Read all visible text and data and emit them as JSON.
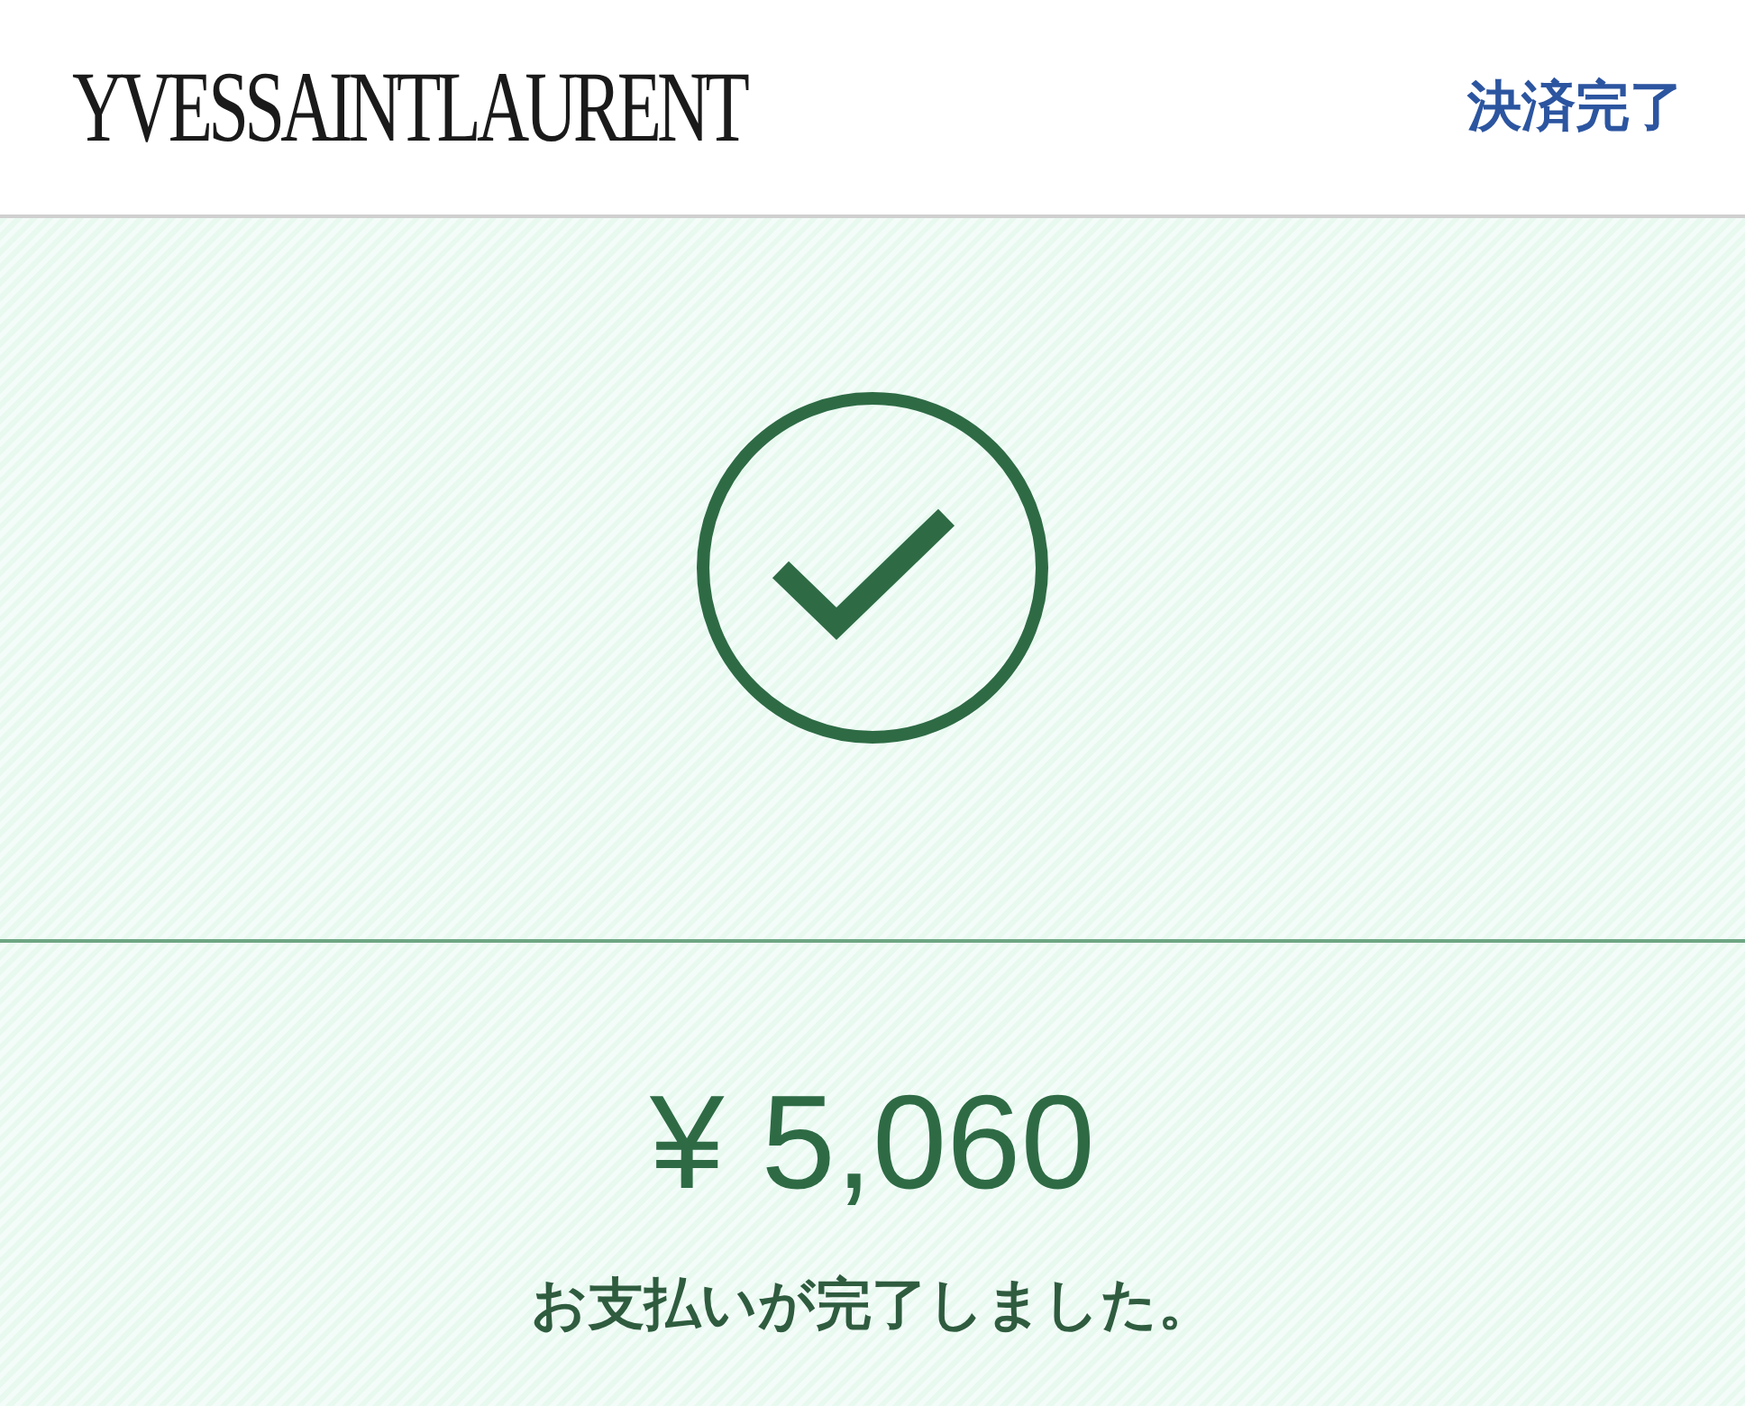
{
  "header": {
    "logo": "YVESSAINTLAURENT",
    "title": "決済完了"
  },
  "status": {
    "kind": "success"
  },
  "amount": "¥ 5,060",
  "message": "お支払いが完了しました。"
}
